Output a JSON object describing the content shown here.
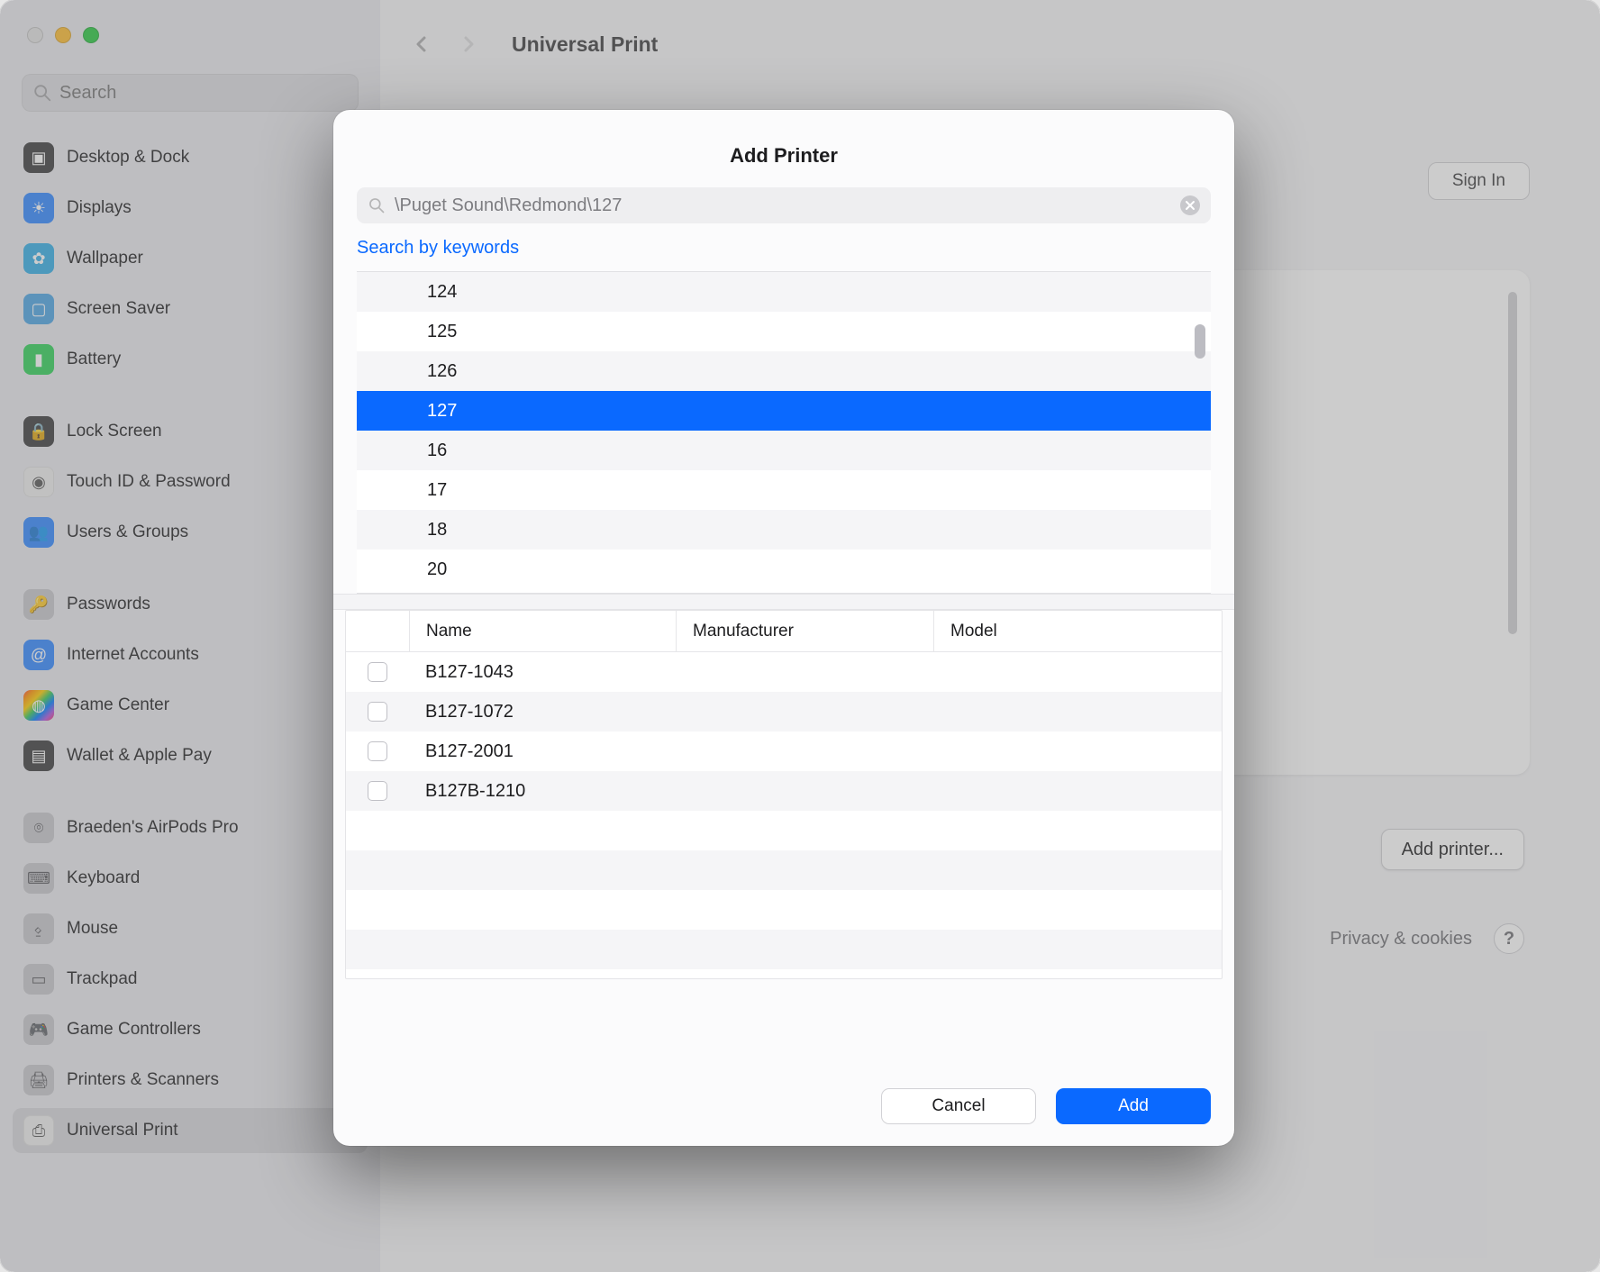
{
  "header": {
    "title": "Universal Print"
  },
  "sidebar": {
    "search_placeholder": "Search",
    "items": [
      {
        "label": "Desktop & Dock"
      },
      {
        "label": "Displays"
      },
      {
        "label": "Wallpaper"
      },
      {
        "label": "Screen Saver"
      },
      {
        "label": "Battery"
      },
      {
        "label": "Lock Screen"
      },
      {
        "label": "Touch ID & Password"
      },
      {
        "label": "Users & Groups"
      },
      {
        "label": "Passwords"
      },
      {
        "label": "Internet Accounts"
      },
      {
        "label": "Game Center"
      },
      {
        "label": "Wallet & Apple Pay"
      },
      {
        "label": "Braeden's AirPods Pro"
      },
      {
        "label": "Keyboard"
      },
      {
        "label": "Mouse"
      },
      {
        "label": "Trackpad"
      },
      {
        "label": "Game Controllers"
      },
      {
        "label": "Printers & Scanners"
      },
      {
        "label": "Universal Print"
      }
    ]
  },
  "content": {
    "sign_in": "Sign In",
    "add_printer": "Add printer...",
    "privacy": "Privacy & cookies",
    "help": "?"
  },
  "modal": {
    "title": "Add Printer",
    "search_value": "\\Puget Sound\\Redmond\\127",
    "search_link": "Search by keywords",
    "folders": [
      "124",
      "125",
      "126",
      "127",
      "16",
      "17",
      "18",
      "20"
    ],
    "selected_folder_index": 3,
    "columns": {
      "name": "Name",
      "manufacturer": "Manufacturer",
      "model": "Model"
    },
    "printers": [
      {
        "name": "B127-1043",
        "manufacturer": "",
        "model": ""
      },
      {
        "name": "B127-1072",
        "manufacturer": "",
        "model": ""
      },
      {
        "name": "B127-2001",
        "manufacturer": "",
        "model": ""
      },
      {
        "name": "B127B-1210",
        "manufacturer": "",
        "model": ""
      }
    ],
    "cancel": "Cancel",
    "add": "Add"
  }
}
